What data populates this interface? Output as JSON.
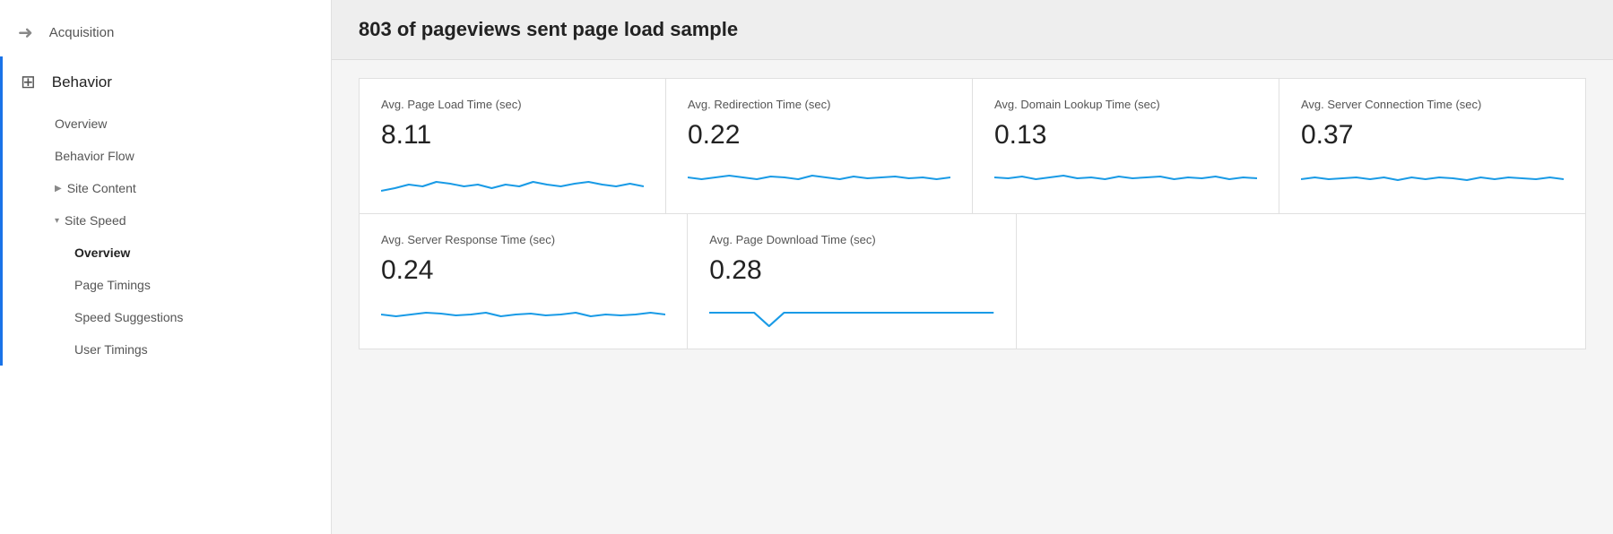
{
  "sidebar": {
    "acquisition_label": "Acquisition",
    "behavior_label": "Behavior",
    "items": [
      {
        "id": "overview",
        "label": "Overview",
        "active": false,
        "expandable": false
      },
      {
        "id": "behavior-flow",
        "label": "Behavior Flow",
        "active": false,
        "expandable": false
      },
      {
        "id": "site-content",
        "label": "Site Content",
        "active": false,
        "expandable": true,
        "expanded": false,
        "arrow": "▶"
      },
      {
        "id": "site-speed",
        "label": "Site Speed",
        "active": false,
        "expandable": true,
        "expanded": true,
        "arrow": "▾"
      },
      {
        "id": "site-speed-overview",
        "label": "Overview",
        "active": true,
        "sub": true
      },
      {
        "id": "page-timings",
        "label": "Page Timings",
        "active": false,
        "sub": true
      },
      {
        "id": "speed-suggestions",
        "label": "Speed Suggestions",
        "active": false,
        "sub": true
      },
      {
        "id": "user-timings",
        "label": "User Timings",
        "active": false,
        "sub": true
      }
    ]
  },
  "main": {
    "header": "803 of pageviews sent page load sample",
    "row1": [
      {
        "id": "avg-page-load",
        "label": "Avg. Page Load Time (sec)",
        "value": "8.11",
        "sparkline": "gentle_wave"
      },
      {
        "id": "avg-redirection",
        "label": "Avg. Redirection Time (sec)",
        "value": "0.22",
        "sparkline": "small_wave"
      },
      {
        "id": "avg-domain-lookup",
        "label": "Avg. Domain Lookup Time (sec)",
        "value": "0.13",
        "sparkline": "tiny_wave"
      },
      {
        "id": "avg-server-connection",
        "label": "Avg. Server Connection Time (sec)",
        "value": "0.37",
        "sparkline": "sparse_wave"
      }
    ],
    "row2": [
      {
        "id": "avg-server-response",
        "label": "Avg. Server Response Time (sec)",
        "value": "0.24",
        "sparkline": "med_wave"
      },
      {
        "id": "avg-page-download",
        "label": "Avg. Page Download Time (sec)",
        "value": "0.28",
        "sparkline": "spike_wave"
      }
    ]
  }
}
